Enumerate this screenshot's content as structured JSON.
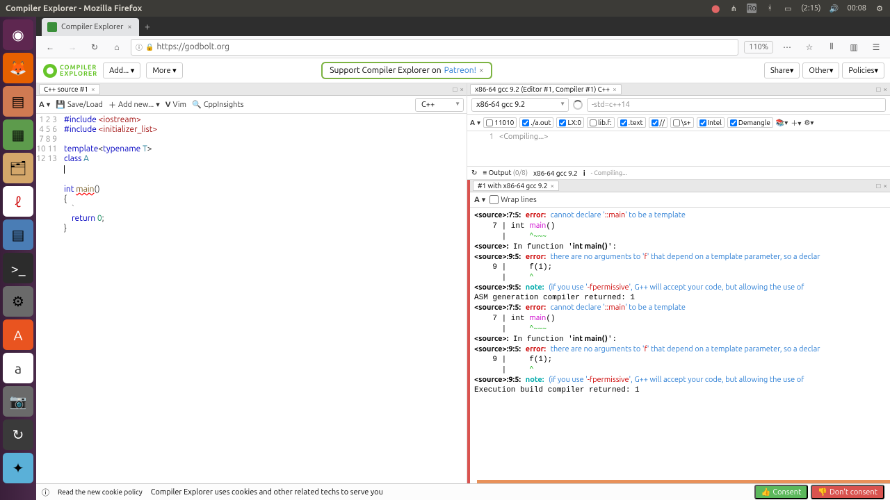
{
  "window": {
    "title": "Compiler Explorer - Mozilla Firefox"
  },
  "tray": {
    "time": "(2:15)",
    "clock": "00:08",
    "lang": "Ro"
  },
  "browser": {
    "tab_title": "Compiler Explorer",
    "url": "https://godbolt.org",
    "zoom": "110%"
  },
  "ce": {
    "logo1": "COMPILER",
    "logo2": "EXPLORER",
    "add": "Add...",
    "more": "More",
    "patreon_pre": "Support Compiler Explorer on ",
    "patreon_link": "Patreon!",
    "share": "Share",
    "other": "Other",
    "policies": "Policies"
  },
  "editor": {
    "tab": "C++ source #1",
    "saveload": "Save/Load",
    "addnew": "Add new...",
    "vim": "Vim",
    "insights": "CppInsights",
    "lang": "C++",
    "lines": [
      "1",
      "2",
      "3",
      "4",
      "5",
      "6",
      "7",
      "8",
      "9",
      "10",
      "11",
      "12",
      "13"
    ]
  },
  "compiler": {
    "tab": "x86-64 gcc 9.2 (Editor #1, Compiler #1) C++",
    "name": "x86-64 gcc 9.2",
    "opts": "-std=c++14",
    "flags": {
      "b11010": "11010",
      "aout": "./a.out",
      "lx0": "LX:0",
      "libf": "lib.f:",
      "text": ".text",
      "slash": "//",
      "s": "\\s+",
      "intel": "Intel",
      "demangle": "Demangle"
    },
    "asm_line": "1",
    "asm": "<Compiling...>",
    "output_label": "Output",
    "output_count": "(0/8)",
    "output_compiler": "x86-64 gcc 9.2",
    "compiling": "- Compiling..."
  },
  "diag": {
    "tab": "#1 with x86-64 gcc 9.2",
    "wrap": "Wrap lines"
  },
  "cookie": {
    "read": "Read the new cookie policy",
    "msg": "Compiler Explorer uses cookies and other related techs to serve you",
    "consent": "Consent",
    "no": "Don't consent"
  }
}
